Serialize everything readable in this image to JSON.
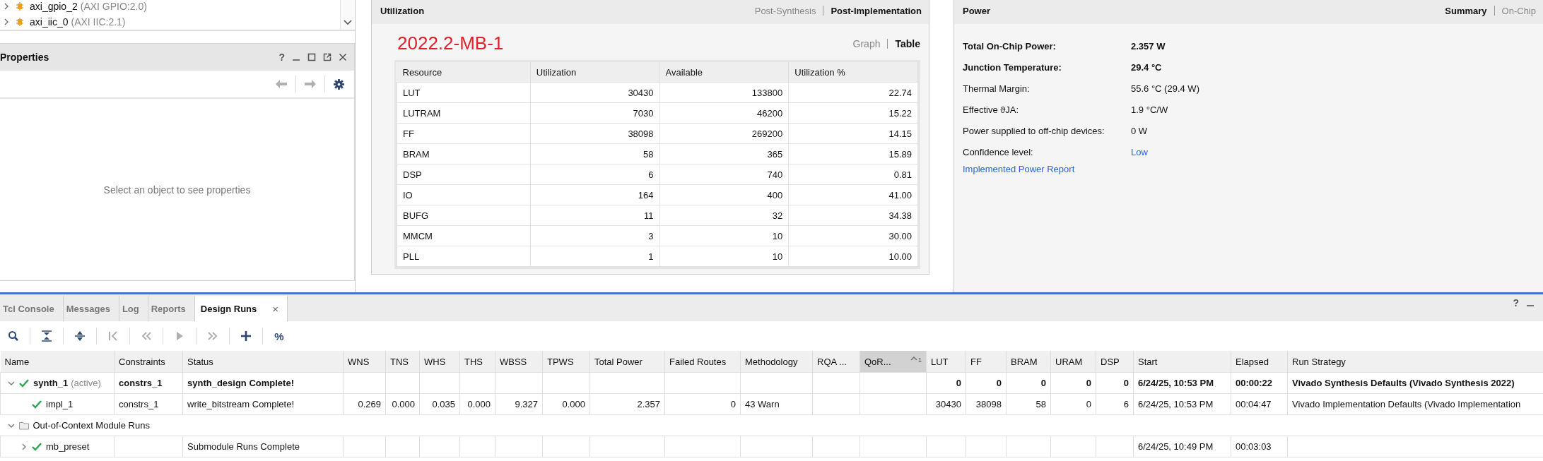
{
  "hierarchy": {
    "items": [
      {
        "name": "axi_gpio_2",
        "detail": "(AXI GPIO:2.0)",
        "expanded": false
      },
      {
        "name": "axi_iic_0",
        "detail": "(AXI IIC:2.1)",
        "expanded": false
      }
    ]
  },
  "properties": {
    "title": "Properties",
    "help": "?",
    "toolbar": [
      {
        "kind": "back",
        "disabled": true
      },
      {
        "kind": "forward",
        "disabled": true
      },
      {
        "kind": "settings",
        "disabled": false
      }
    ],
    "empty_message": "Select an object to see properties"
  },
  "utilization": {
    "title": "Utilization",
    "views": [
      {
        "label": "Post-Synthesis",
        "selected": false
      },
      {
        "label": "Post-Implementation",
        "selected": true
      }
    ],
    "heading": "2022.2-MB-1",
    "modes": [
      {
        "label": "Graph",
        "selected": false
      },
      {
        "label": "Table",
        "selected": true
      }
    ],
    "columns": [
      "Resource",
      "Utilization",
      "Available",
      "Utilization %"
    ],
    "rows": [
      [
        "LUT",
        "30430",
        "133800",
        "22.74"
      ],
      [
        "LUTRAM",
        "7030",
        "46200",
        "15.22"
      ],
      [
        "FF",
        "38098",
        "269200",
        "14.15"
      ],
      [
        "BRAM",
        "58",
        "365",
        "15.89"
      ],
      [
        "DSP",
        "6",
        "740",
        "0.81"
      ],
      [
        "IO",
        "164",
        "400",
        "41.00"
      ],
      [
        "BUFG",
        "11",
        "32",
        "34.38"
      ],
      [
        "MMCM",
        "3",
        "10",
        "30.00"
      ],
      [
        "PLL",
        "1",
        "10",
        "10.00"
      ]
    ]
  },
  "power": {
    "title": "Power",
    "views": [
      {
        "label": "Summary",
        "selected": true
      },
      {
        "label": "On-Chip",
        "selected": false
      }
    ],
    "rows": [
      {
        "label": "Total On-Chip Power:",
        "value": "2.357 W",
        "emphasis": true,
        "kind": "text"
      },
      {
        "label": "Junction Temperature:",
        "value": "29.4 °C",
        "emphasis": true,
        "kind": "text"
      },
      {
        "label": "Thermal Margin:",
        "value": "55.6 °C (29.4 W)",
        "emphasis": false,
        "kind": "text"
      },
      {
        "label": "Effective ϑJA:",
        "value": "1.9 °C/W",
        "emphasis": false,
        "kind": "text"
      },
      {
        "label": "Power supplied to off-chip devices:",
        "value": "0 W",
        "emphasis": false,
        "kind": "text"
      },
      {
        "label": "Confidence level:",
        "value": "Low",
        "emphasis": false,
        "kind": "link"
      }
    ],
    "report_link": "Implemented Power Report"
  },
  "bottom_panel": {
    "tabs": [
      {
        "label": "Tcl Console",
        "selected": false
      },
      {
        "label": "Messages",
        "selected": false
      },
      {
        "label": "Log",
        "selected": false
      },
      {
        "label": "Reports",
        "selected": false
      },
      {
        "label": "Design Runs",
        "selected": true
      }
    ],
    "close": "×",
    "help": "?",
    "toolbar": [
      {
        "kind": "search",
        "disabled": false
      },
      {
        "kind": "collapse",
        "disabled": false
      },
      {
        "kind": "expand",
        "disabled": false
      },
      {
        "kind": "first",
        "disabled": true
      },
      {
        "kind": "previous",
        "disabled": true
      },
      {
        "kind": "play",
        "disabled": true
      },
      {
        "kind": "next",
        "disabled": true
      },
      {
        "kind": "add",
        "disabled": false
      },
      {
        "kind": "percent",
        "label": "%",
        "disabled": false
      }
    ],
    "columns": [
      {
        "label": "Name",
        "kind": "text",
        "sorted": false
      },
      {
        "label": "Constraints",
        "kind": "text",
        "sorted": false
      },
      {
        "label": "Status",
        "kind": "text",
        "sorted": false
      },
      {
        "label": "WNS",
        "kind": "number",
        "sorted": false
      },
      {
        "label": "TNS",
        "kind": "number",
        "sorted": false
      },
      {
        "label": "WHS",
        "kind": "number",
        "sorted": false
      },
      {
        "label": "THS",
        "kind": "number",
        "sorted": false
      },
      {
        "label": "WBSS",
        "kind": "number",
        "sorted": false
      },
      {
        "label": "TPWS",
        "kind": "number",
        "sorted": false
      },
      {
        "label": "Total Power",
        "kind": "number",
        "sorted": false
      },
      {
        "label": "Failed Routes",
        "kind": "number",
        "sorted": false
      },
      {
        "label": "Methodology",
        "kind": "text",
        "sorted": false
      },
      {
        "label": "RQA ...",
        "kind": "text",
        "sorted": false
      },
      {
        "label": "QoR...",
        "kind": "text",
        "sorted": true,
        "sort_rank": "1"
      },
      {
        "label": "LUT",
        "kind": "number",
        "sorted": false
      },
      {
        "label": "FF",
        "kind": "number",
        "sorted": false
      },
      {
        "label": "BRAM",
        "kind": "number",
        "sorted": false
      },
      {
        "label": "URAM",
        "kind": "number",
        "sorted": false
      },
      {
        "label": "DSP",
        "kind": "number",
        "sorted": false
      },
      {
        "label": "Start",
        "kind": "text",
        "sorted": false
      },
      {
        "label": "Elapsed",
        "kind": "text",
        "sorted": false
      },
      {
        "label": "Run Strategy",
        "kind": "text",
        "sorted": false
      }
    ],
    "runs": [
      {
        "kind": "run",
        "name": "synth_1",
        "note": "(active)",
        "active": true,
        "complete": true,
        "expanded": true,
        "cells": [
          "constrs_1",
          "synth_design Complete!",
          null,
          null,
          null,
          null,
          null,
          null,
          null,
          null,
          null,
          null,
          null,
          "0",
          "0",
          "0",
          "0",
          "0",
          "6/24/25, 10:53 PM",
          "00:00:22",
          "Vivado Synthesis Defaults (Vivado Synthesis 2022)"
        ],
        "children": [
          {
            "kind": "run",
            "name": "impl_1",
            "active": false,
            "complete": true,
            "cells": [
              "constrs_1",
              "write_bitstream Complete!",
              "0.269",
              "0.000",
              "0.035",
              "0.000",
              "9.327",
              "0.000",
              "2.357",
              "0",
              "43 Warn",
              null,
              null,
              "30430",
              "38098",
              "58",
              "0",
              "6",
              "6/24/25, 10:53 PM",
              "00:04:47",
              "Vivado Implementation Defaults (Vivado Implementation"
            ]
          }
        ]
      },
      {
        "kind": "group",
        "name": "Out-of-Context Module Runs",
        "expanded": true,
        "children": [
          {
            "kind": "run",
            "name": "mb_preset",
            "active": false,
            "complete": true,
            "expanded": false,
            "cells": [
              null,
              "Submodule Runs Complete",
              null,
              null,
              null,
              null,
              null,
              null,
              null,
              null,
              null,
              null,
              null,
              null,
              null,
              null,
              null,
              null,
              "6/24/25, 10:49 PM",
              "00:03:03",
              null
            ]
          }
        ]
      }
    ]
  }
}
